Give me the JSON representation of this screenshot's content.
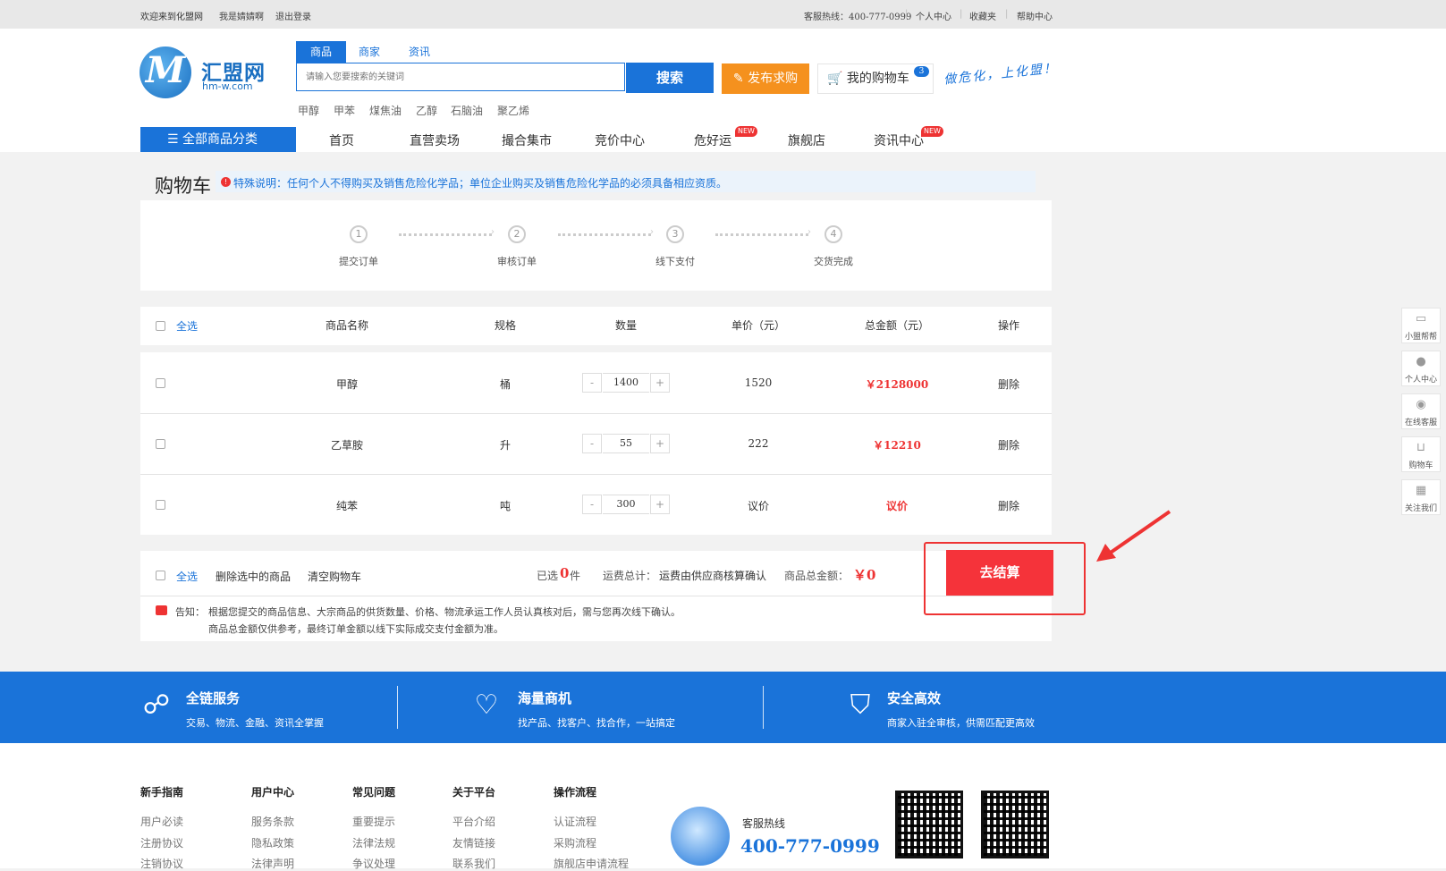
{
  "topbar": {
    "welcome": "欢迎来到化盟网",
    "user": "我是婧婧啊",
    "logout": "退出登录",
    "hotline": "客服热线：400-777-0999",
    "personal": "个人中心",
    "favorites": "收藏夹",
    "help": "帮助中心"
  },
  "logo": {
    "cn": "汇盟网",
    "en": "hm-w.com"
  },
  "search": {
    "tabs": [
      "商品",
      "商家",
      "资讯"
    ],
    "placeholder": "请输入您要搜索的关键词",
    "button": "搜索",
    "hotwords": [
      "甲醇",
      "甲苯",
      "煤焦油",
      "乙醇",
      "石脑油",
      "聚乙烯"
    ]
  },
  "header": {
    "publish": "发布求购",
    "cart": "我的购物车",
    "cart_count": "3",
    "slogan": "做危化，上化盟！"
  },
  "nav": {
    "all_categories": "全部商品分类",
    "items": [
      "首页",
      "直营卖场",
      "撮合集市",
      "竞价中心",
      "危好运",
      "旗舰店",
      "资讯中心"
    ],
    "new_tag": "NEW"
  },
  "page": {
    "title": "购物车",
    "notice": "特殊说明：任何个人不得购买及销售危险化学品；单位企业购买及销售危险化学品的必须具备相应资质。"
  },
  "steps": [
    {
      "num": "1",
      "label": "提交订单"
    },
    {
      "num": "2",
      "label": "审核订单"
    },
    {
      "num": "3",
      "label": "线下支付"
    },
    {
      "num": "4",
      "label": "交货完成"
    }
  ],
  "table": {
    "select_all": "全选",
    "headers": [
      "商品名称",
      "规格",
      "数量",
      "单价（元）",
      "总金额（元）",
      "操作"
    ],
    "rows": [
      {
        "name": "甲醇",
        "spec": "桶",
        "qty": "1400",
        "price": "1520",
        "total": "￥2128000",
        "action": "删除"
      },
      {
        "name": "乙草胺",
        "spec": "升",
        "qty": "55",
        "price": "222",
        "total": "￥12210",
        "action": "删除"
      },
      {
        "name": "纯苯",
        "spec": "吨",
        "qty": "300",
        "price": "议价",
        "total": "议价",
        "action": "删除"
      }
    ],
    "minus": "-",
    "plus": "+"
  },
  "summary": {
    "select_all": "全选",
    "delete_selected": "删除选中的商品",
    "clear_cart": "清空购物车",
    "selected_prefix": "已选",
    "selected_count": "0",
    "selected_suffix": "件",
    "shipping_label": "运费总计：",
    "shipping_value": "运费由供应商核算确认",
    "amount_label": "商品总金额：",
    "amount_value": "￥0",
    "checkout": "去结算",
    "notice_label": "告知：",
    "notice_line1": "根据您提交的商品信息、大宗商品的供货数量、价格、物流承运工作人员认真核对后，需与您再次线下确认。",
    "notice_line2": "商品总金额仅供参考，最终订单金额以线下实际成交支付金额为准。"
  },
  "side_tools": [
    "小盟帮帮",
    "个人中心",
    "在线客服",
    "购物车",
    "关注我们"
  ],
  "band": [
    {
      "title": "全链服务",
      "sub": "交易、物流、金融、资讯全掌握",
      "icon": "network-icon"
    },
    {
      "title": "海量商机",
      "sub": "找产品、找客户、找合作，一站搞定",
      "icon": "handshake-icon"
    },
    {
      "title": "安全高效",
      "sub": "商家入驻全审核，供需匹配更高效",
      "icon": "shield-icon"
    }
  ],
  "footer": {
    "columns": [
      {
        "title": "新手指南",
        "items": [
          "用户必读",
          "注册协议",
          "注销协议"
        ]
      },
      {
        "title": "用户中心",
        "items": [
          "服务条款",
          "隐私政策",
          "法律声明"
        ]
      },
      {
        "title": "常见问题",
        "items": [
          "重要提示",
          "法律法规",
          "争议处理"
        ]
      },
      {
        "title": "关于平台",
        "items": [
          "平台介绍",
          "友情链接",
          "联系我们"
        ]
      },
      {
        "title": "操作流程",
        "items": [
          "认证流程",
          "采购流程",
          "旗舰店申请流程"
        ]
      }
    ],
    "hotline_label": "客服热线",
    "hotline": "400-777-0999"
  },
  "colors": {
    "brand": "#1a73d9",
    "accent": "#f5911e",
    "checkout": "#f5333a",
    "price": "#e33333"
  }
}
